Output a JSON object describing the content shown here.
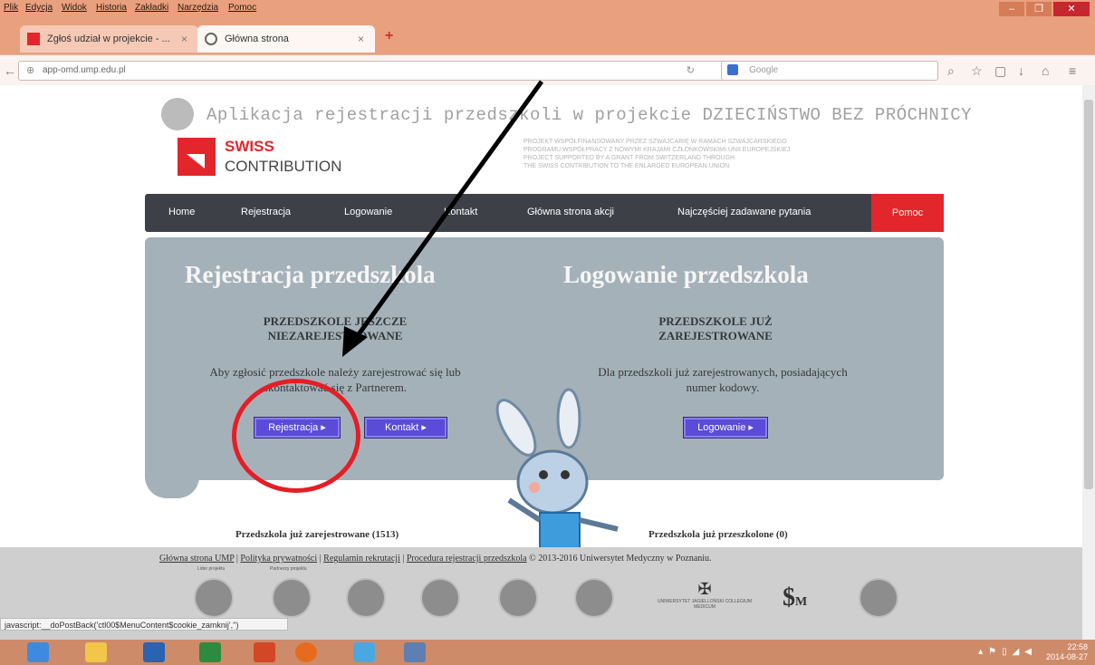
{
  "browser": {
    "menu": [
      "Plik",
      "Edycja",
      "Widok",
      "Historia",
      "Zakładki",
      "Narzędzia",
      "Pomoc"
    ],
    "window_controls": {
      "minimize": "–",
      "maximize": "❐",
      "close": "✕"
    },
    "tabs": [
      {
        "label": "Zgłoś udział w projekcie - ...",
        "close": "×"
      },
      {
        "label": "Główna strona",
        "close": "×"
      }
    ],
    "new_tab": "+",
    "url": "app-omd.ump.edu.pl",
    "search_placeholder": "Google",
    "status_url": "javascript:__doPostBack('ctl00$MenuContent$cookie_zamknij','')"
  },
  "site": {
    "title": "Aplikacja rejestracji przedszkoli w projekcie DZIECIŃSTWO BEZ PRÓCHNICY",
    "logo_name": "SWISS",
    "logo_subname": "CONTRIBUTION",
    "partner_lines": [
      "PROJEKT WSPÓŁFINANSOWANY PRZEZ SZWAJCARIĘ W RAMACH SZWAJCARSKIEGO",
      "PROGRAMU WSPÓŁPRACY Z NOWYMI KRAJAMI CZŁONKOWSKIMI UNII EUROPEJSKIEJ",
      "PROJECT SUPPORTED BY A GRANT FROM SWITZERLAND THROUGH",
      "THE SWISS CONTRIBUTION TO THE ENLARGED EUROPEAN UNION"
    ]
  },
  "nav": {
    "items": [
      "Home",
      "Rejestracja",
      "Logowanie",
      "Kontakt",
      "Główna strona akcji",
      "Najczęściej zadawane pytania"
    ],
    "help": "Pomoc"
  },
  "register": {
    "heading": "Rejestracja przedszkola",
    "subheading": "PRZEDSZKOLE JESZCZE NIEZAREJESTROWANE",
    "description": "Aby zgłosić przedszkole należy zarejestrować się lub skontaktować się z Partnerem.",
    "btn_register": "Rejestracja ▸",
    "btn_contact": "Kontakt ▸"
  },
  "login": {
    "heading": "Logowanie przedszkola",
    "subheading": "PRZEDSZKOLE JUŻ ZAREJESTROWANE",
    "description": "Dla przedszkoli już zarejestrowanych, posiadających numer kodowy.",
    "btn_login": "Logowanie ▸"
  },
  "stats": {
    "registered": "Przedszkola już zarejestrowane (1513)",
    "trained": "Przedszkola już przeszkolone (0)"
  },
  "footer": {
    "links": [
      "Główna strona UMP",
      "Polityka prywatności",
      "Regulamin rekrutacji",
      "Procedura rejestracji przedszkola"
    ],
    "copyright": "© 2013-2016 Uniwersytet Medyczny w Poznaniu.",
    "caption_leader": "Lider projektu",
    "caption_partners": "Partnerzy projektu",
    "partner_text": "UNIWERSYTET JAGIELLOŃSKI COLLEGIUM MEDICUM"
  },
  "taskbar": {
    "time": "22:58",
    "date": "2014-08-27"
  },
  "colors": {
    "brand_red": "#e3262b",
    "nav_dark": "#3d4147",
    "panel": "#a5b1b9",
    "button": "#5a4bd8",
    "annotation": "#e51d25"
  }
}
